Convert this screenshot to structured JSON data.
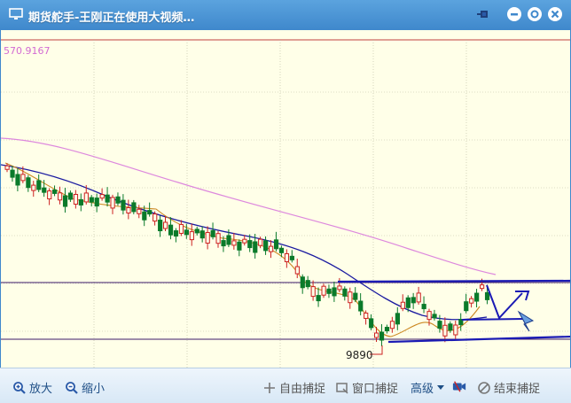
{
  "window": {
    "title": "期货舵手-王刚正在使用大视频…"
  },
  "chart": {
    "top_price_label": "570.9167",
    "low_price_label": "9890",
    "colors": {
      "up": "#cc2222",
      "down": "#0a7a2a",
      "ma_short": "#cc8822",
      "ma_mid": "#1a1aa0",
      "ma_long": "#dd88dd",
      "annotation": "#1a1ab4"
    }
  },
  "toolbar": {
    "zoom_in": "放大",
    "zoom_out": "缩小",
    "free_capture": "自由捕捉",
    "window_capture": "窗口捕捉",
    "advanced": "高级",
    "end_capture": "结束捕捉"
  }
}
